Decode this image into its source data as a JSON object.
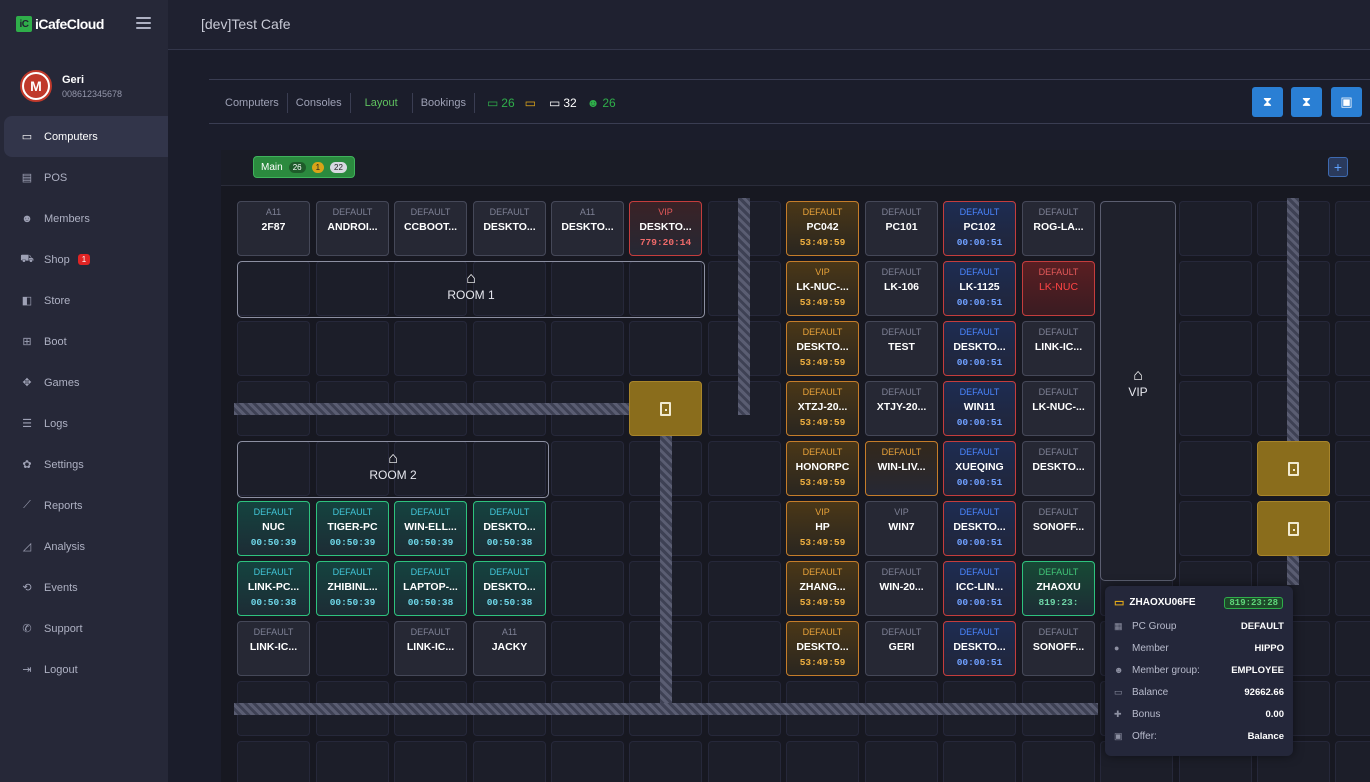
{
  "app": {
    "logo": "iCafeCloud",
    "logo_mark": "iC",
    "cafe_name": "[dev]Test Cafe"
  },
  "profile": {
    "name": "Geri",
    "phone": "008612345678",
    "avatar_letter": "M"
  },
  "nav": [
    {
      "label": "Computers",
      "icon": "monitor-icon",
      "glyph": "▭"
    },
    {
      "label": "POS",
      "icon": "pos-icon",
      "glyph": "▤"
    },
    {
      "label": "Members",
      "icon": "members-icon",
      "glyph": "☻"
    },
    {
      "label": "Shop",
      "icon": "cart-icon",
      "glyph": "⛟",
      "badge": "1"
    },
    {
      "label": "Store",
      "icon": "store-icon",
      "glyph": "◧"
    },
    {
      "label": "Boot",
      "icon": "windows-icon",
      "glyph": "⊞"
    },
    {
      "label": "Games",
      "icon": "gamepad-icon",
      "glyph": "✥"
    },
    {
      "label": "Logs",
      "icon": "list-icon",
      "glyph": "☰"
    },
    {
      "label": "Settings",
      "icon": "gear-icon",
      "glyph": "✿"
    },
    {
      "label": "Reports",
      "icon": "line-chart-icon",
      "glyph": "⟋"
    },
    {
      "label": "Analysis",
      "icon": "area-chart-icon",
      "glyph": "◿"
    },
    {
      "label": "Events",
      "icon": "events-icon",
      "glyph": "⟲"
    },
    {
      "label": "Support",
      "icon": "phone-icon",
      "glyph": "✆"
    },
    {
      "label": "Logout",
      "icon": "logout-icon",
      "glyph": "⇥"
    }
  ],
  "tabs": [
    "Computers",
    "Consoles",
    "Layout",
    "Bookings"
  ],
  "stats": [
    {
      "value": "26",
      "color": "#2fae4a",
      "icon": "monitor-online-icon"
    },
    {
      "value": "",
      "color": "#e0a81a",
      "icon": "monitor-warn-icon"
    },
    {
      "value": "32",
      "color": "#ffffff",
      "icon": "monitor-total-icon"
    },
    {
      "value": "26",
      "color": "#2fae4a",
      "icon": "user-icon"
    }
  ],
  "room_tab": {
    "label": "Main",
    "a": "26",
    "b": "1",
    "c": "22"
  },
  "rooms": [
    {
      "label": "ROOM 1"
    },
    {
      "label": "ROOM 2"
    },
    {
      "label": "VIP"
    }
  ],
  "computers": [
    {
      "group": "A11",
      "name": "2F87",
      "time": "",
      "style": ""
    },
    {
      "group": "DEFAULT",
      "name": "ANDROI...",
      "time": "",
      "style": ""
    },
    {
      "group": "DEFAULT",
      "name": "CCBOOT...",
      "time": "",
      "style": ""
    },
    {
      "group": "DEFAULT",
      "name": "DESKTO...",
      "time": "",
      "style": ""
    },
    {
      "group": "A11",
      "name": "DESKTO...",
      "time": "",
      "style": ""
    },
    {
      "group": "VIP",
      "name": "DESKTO...",
      "time": "779:20:14",
      "style": "vipr"
    },
    {
      "group": "DEFAULT",
      "name": "NUC",
      "time": "00:50:39",
      "style": "teal"
    },
    {
      "group": "DEFAULT",
      "name": "TIGER-PC",
      "time": "00:50:39",
      "style": "teal"
    },
    {
      "group": "DEFAULT",
      "name": "WIN-ELL...",
      "time": "00:50:39",
      "style": "teal"
    },
    {
      "group": "DEFAULT",
      "name": "DESKTO...",
      "time": "00:50:38",
      "style": "teal"
    },
    {
      "group": "DEFAULT",
      "name": "LINK-PC...",
      "time": "00:50:38",
      "style": "teal"
    },
    {
      "group": "DEFAULT",
      "name": "ZHIBINL...",
      "time": "00:50:39",
      "style": "teal"
    },
    {
      "group": "DEFAULT",
      "name": "LAPTOP-...",
      "time": "00:50:38",
      "style": "teal"
    },
    {
      "group": "DEFAULT",
      "name": "DESKTO...",
      "time": "00:50:38",
      "style": "teal"
    },
    {
      "group": "DEFAULT",
      "name": "LINK-IC...",
      "time": "",
      "style": ""
    },
    {
      "group": "DEFAULT",
      "name": "LINK-IC...",
      "time": "",
      "style": ""
    },
    {
      "group": "A11",
      "name": "JACKY",
      "time": "",
      "style": ""
    },
    {
      "group": "DEFAULT",
      "name": "PC042",
      "time": "53:49:59",
      "style": "orange"
    },
    {
      "group": "DEFAULT",
      "name": "PC101",
      "time": "",
      "style": ""
    },
    {
      "group": "DEFAULT",
      "name": "PC102",
      "time": "00:00:51",
      "style": "blue"
    },
    {
      "group": "DEFAULT",
      "name": "ROG-LA...",
      "time": "",
      "style": ""
    },
    {
      "group": "VIP",
      "name": "LK-NUC-...",
      "time": "53:49:59",
      "style": "orange"
    },
    {
      "group": "DEFAULT",
      "name": "LK-106",
      "time": "",
      "style": ""
    },
    {
      "group": "DEFAULT",
      "name": "LK-1125",
      "time": "00:00:51",
      "style": "blue"
    },
    {
      "group": "DEFAULT",
      "name": "LK-NUC",
      "time": "",
      "style": "red"
    },
    {
      "group": "DEFAULT",
      "name": "DESKTO...",
      "time": "53:49:59",
      "style": "orange"
    },
    {
      "group": "DEFAULT",
      "name": "TEST",
      "time": "",
      "style": ""
    },
    {
      "group": "DEFAULT",
      "name": "DESKTO...",
      "time": "00:00:51",
      "style": "blue"
    },
    {
      "group": "DEFAULT",
      "name": "LINK-IC...",
      "time": "",
      "style": ""
    },
    {
      "group": "DEFAULT",
      "name": "XTZJ-20...",
      "time": "53:49:59",
      "style": "orange"
    },
    {
      "group": "DEFAULT",
      "name": "XTJY-20...",
      "time": "",
      "style": ""
    },
    {
      "group": "DEFAULT",
      "name": "WIN11",
      "time": "00:00:51",
      "style": "blue"
    },
    {
      "group": "DEFAULT",
      "name": "LK-NUC-...",
      "time": "",
      "style": ""
    },
    {
      "group": "DEFAULT",
      "name": "HONORPC",
      "time": "53:49:59",
      "style": "orange"
    },
    {
      "group": "DEFAULT",
      "name": "WIN-LIV...",
      "time": "",
      "style": "orangeb"
    },
    {
      "group": "DEFAULT",
      "name": "XUEQING",
      "time": "00:00:51",
      "style": "blue"
    },
    {
      "group": "DEFAULT",
      "name": "DESKTO...",
      "time": "",
      "style": ""
    },
    {
      "group": "VIP",
      "name": "HP",
      "time": "53:49:59",
      "style": "orange"
    },
    {
      "group": "VIP",
      "name": "WIN7",
      "time": "",
      "style": ""
    },
    {
      "group": "DEFAULT",
      "name": "DESKTO...",
      "time": "00:00:51",
      "style": "blue"
    },
    {
      "group": "DEFAULT",
      "name": "SONOFF...",
      "time": "",
      "style": ""
    },
    {
      "group": "DEFAULT",
      "name": "ZHANG...",
      "time": "53:49:59",
      "style": "orange"
    },
    {
      "group": "DEFAULT",
      "name": "WIN-20...",
      "time": "",
      "style": ""
    },
    {
      "group": "DEFAULT",
      "name": "ICC-LIN...",
      "time": "00:00:51",
      "style": "blue"
    },
    {
      "group": "DEFAULT",
      "name": "ZHAOXU",
      "time": "819:23:",
      "style": "greenbox"
    },
    {
      "group": "DEFAULT",
      "name": "DESKTO...",
      "time": "53:49:59",
      "style": "orange"
    },
    {
      "group": "DEFAULT",
      "name": "GERI",
      "time": "",
      "style": ""
    },
    {
      "group": "DEFAULT",
      "name": "DESKTO...",
      "time": "00:00:51",
      "style": "blue"
    },
    {
      "group": "DEFAULT",
      "name": "SONOFF...",
      "time": "",
      "style": ""
    }
  ],
  "tooltip": {
    "title": "ZHAOXU06FE",
    "time": "819:23:28",
    "rows": [
      {
        "label": "PC Group",
        "value": "DEFAULT",
        "icon": "pc-group-icon",
        "glyph": "▦"
      },
      {
        "label": "Member",
        "value": "HIPPO",
        "icon": "member-icon",
        "glyph": "●"
      },
      {
        "label": "Member group:",
        "value": "EMPLOYEE",
        "icon": "member-group-icon",
        "glyph": "☻"
      },
      {
        "label": "Balance",
        "value": "92662.66",
        "icon": "balance-icon",
        "glyph": "▭"
      },
      {
        "label": "Bonus",
        "value": "0.00",
        "icon": "bonus-icon",
        "glyph": "✚"
      },
      {
        "label": "Offer:",
        "value": "Balance",
        "icon": "offer-icon",
        "glyph": "▣"
      }
    ]
  }
}
